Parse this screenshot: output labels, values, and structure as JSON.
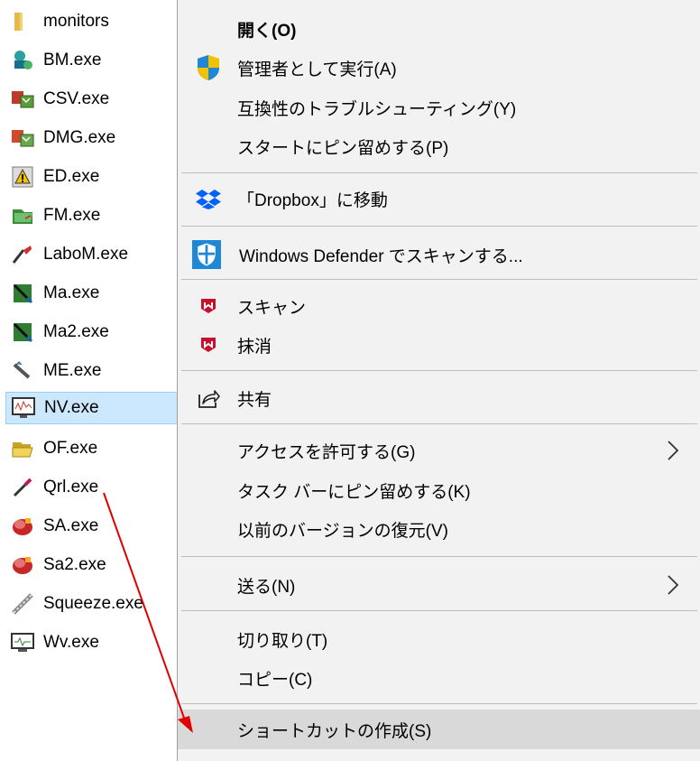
{
  "files": [
    {
      "name": "monitors",
      "icon": "folder-icon"
    },
    {
      "name": "BM.exe",
      "icon": "app-icon-bm"
    },
    {
      "name": "CSV.exe",
      "icon": "app-icon-csv"
    },
    {
      "name": "DMG.exe",
      "icon": "app-icon-dmg"
    },
    {
      "name": "ED.exe",
      "icon": "warning-app-icon"
    },
    {
      "name": "FM.exe",
      "icon": "app-icon-fm"
    },
    {
      "name": "LaboM.exe",
      "icon": "app-icon-labom"
    },
    {
      "name": "Ma.exe",
      "icon": "app-icon-ma"
    },
    {
      "name": "Ma2.exe",
      "icon": "app-icon-ma2"
    },
    {
      "name": "ME.exe",
      "icon": "app-icon-me"
    },
    {
      "name": "NV.exe",
      "icon": "app-icon-nv",
      "selected": true
    },
    {
      "name": "OF.exe",
      "icon": "open-folder-icon"
    },
    {
      "name": "Qrl.exe",
      "icon": "app-icon-qrl"
    },
    {
      "name": "SA.exe",
      "icon": "app-icon-sa"
    },
    {
      "name": "Sa2.exe",
      "icon": "app-icon-sa2"
    },
    {
      "name": "Squeeze.exe",
      "icon": "app-icon-squeeze"
    },
    {
      "name": "Wv.exe",
      "icon": "app-icon-wv"
    }
  ],
  "context_menu": {
    "open": "開く(O)",
    "run_as_admin": "管理者として実行(A)",
    "compat_troubleshoot": "互換性のトラブルシューティング(Y)",
    "pin_to_start": "スタートにピン留めする(P)",
    "dropbox_move": "「Dropbox」に移動",
    "defender_scan": "Windows Defender でスキャンする...",
    "mcafee_scan": "スキャン",
    "mcafee_shred": "抹消",
    "share": "共有",
    "give_access": "アクセスを許可する(G)",
    "pin_to_taskbar": "タスク バーにピン留めする(K)",
    "restore_versions": "以前のバージョンの復元(V)",
    "send_to": "送る(N)",
    "cut": "切り取り(T)",
    "copy": "コピー(C)",
    "create_shortcut": "ショートカットの作成(S)"
  },
  "colors": {
    "menu_background": "#f2f2f2",
    "menu_hover": "#d9d9d9",
    "selection_background": "#cce8ff",
    "selection_border": "#99d1ff",
    "annotation_arrow": "#e00000",
    "shield_blue": "#1e88d6",
    "mcafee_red": "#c8102e",
    "dropbox_blue": "#0061fe"
  }
}
